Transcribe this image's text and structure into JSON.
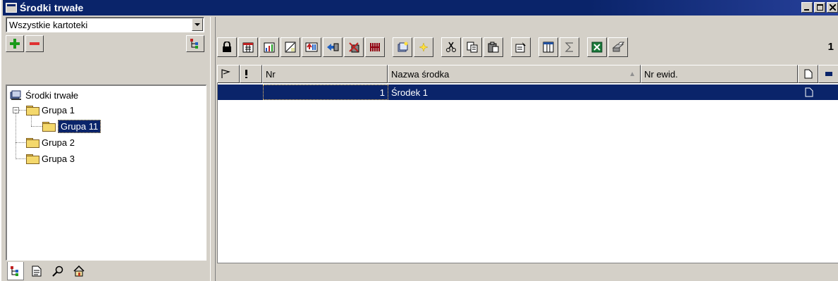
{
  "window": {
    "title": "Środki trwałe"
  },
  "left": {
    "combo_value": "Wszystkie kartoteki",
    "tree": {
      "root": "Środki trwałe",
      "items": [
        "Grupa 1",
        "Grupa 11",
        "Grupa 2",
        "Grupa 3"
      ],
      "selected": "Grupa 11"
    }
  },
  "toolbar": {
    "record_count": "1"
  },
  "grid": {
    "columns": [
      "Nr",
      "Nazwa środka",
      "Nr ewid."
    ],
    "rows": [
      {
        "nr": "1",
        "name": "Środek 1"
      }
    ]
  },
  "colors": {
    "titlebar": "#0a246a",
    "selection": "#0a246a",
    "face": "#d4d0c8"
  }
}
